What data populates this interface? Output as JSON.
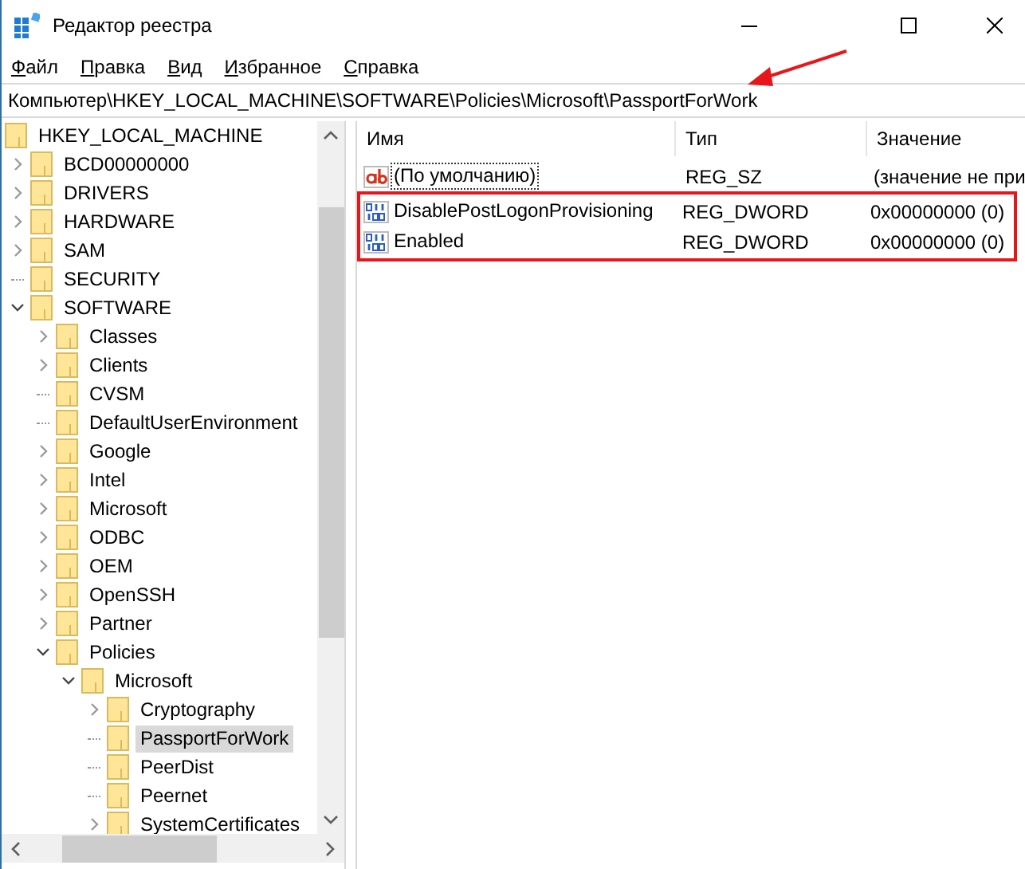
{
  "window": {
    "title": "Редактор реестра"
  },
  "menu": [
    {
      "label": "Файл"
    },
    {
      "label": "Правка"
    },
    {
      "label": "Вид"
    },
    {
      "label": "Избранное"
    },
    {
      "label": "Справка"
    }
  ],
  "address": "Компьютер\\HKEY_LOCAL_MACHINE\\SOFTWARE\\Policies\\Microsoft\\PassportForWork",
  "address_arrow": true,
  "tree": [
    {
      "label": "HKEY_LOCAL_MACHINE",
      "selected": false,
      "children": [
        {
          "label": "BCD00000000",
          "expandable": true,
          "expanded": false,
          "selected": false
        },
        {
          "label": "DRIVERS",
          "expandable": true,
          "expanded": false,
          "selected": false
        },
        {
          "label": "HARDWARE",
          "expandable": true,
          "expanded": false,
          "selected": false
        },
        {
          "label": "SAM",
          "expandable": true,
          "expanded": false,
          "selected": false
        },
        {
          "label": "SECURITY",
          "expandable": false,
          "selected": false
        },
        {
          "label": "SOFTWARE",
          "expandable": true,
          "expanded": true,
          "selected": false,
          "children": [
            {
              "label": "Classes",
              "expandable": true,
              "expanded": false,
              "selected": false
            },
            {
              "label": "Clients",
              "expandable": true,
              "expanded": false,
              "selected": false
            },
            {
              "label": "CVSM",
              "expandable": false,
              "selected": false
            },
            {
              "label": "DefaultUserEnvironment",
              "expandable": false,
              "selected": false
            },
            {
              "label": "Google",
              "expandable": true,
              "expanded": false,
              "selected": false
            },
            {
              "label": "Intel",
              "expandable": true,
              "expanded": false,
              "selected": false
            },
            {
              "label": "Microsoft",
              "expandable": true,
              "expanded": false,
              "selected": false
            },
            {
              "label": "ODBC",
              "expandable": true,
              "expanded": false,
              "selected": false
            },
            {
              "label": "OEM",
              "expandable": true,
              "expanded": false,
              "selected": false
            },
            {
              "label": "OpenSSH",
              "expandable": true,
              "expanded": false,
              "selected": false
            },
            {
              "label": "Partner",
              "expandable": true,
              "expanded": false,
              "selected": false
            },
            {
              "label": "Policies",
              "expandable": true,
              "expanded": true,
              "selected": false,
              "children": [
                {
                  "label": "Microsoft",
                  "expandable": true,
                  "expanded": true,
                  "selected": false,
                  "children": [
                    {
                      "label": "Cryptography",
                      "expandable": true,
                      "expanded": false,
                      "selected": false
                    },
                    {
                      "label": "PassportForWork",
                      "expandable": false,
                      "selected": true
                    },
                    {
                      "label": "PeerDist",
                      "expandable": false,
                      "selected": false
                    },
                    {
                      "label": "Peernet",
                      "expandable": false,
                      "selected": false
                    },
                    {
                      "label": "SystemCertificates",
                      "expandable": true,
                      "expanded": false,
                      "selected": false
                    }
                  ]
                }
              ]
            }
          ]
        }
      ]
    }
  ],
  "table": {
    "columns": [
      "Имя",
      "Тип",
      "Значение"
    ],
    "rows": [
      {
        "kind": "string",
        "name": "(По умолчанию)",
        "type": "REG_SZ",
        "value": "(значение не при",
        "focused": true,
        "highlighted": false
      },
      {
        "kind": "dword",
        "name": "DisablePostLogonProvisioning",
        "type": "REG_DWORD",
        "value": "0x00000000 (0)",
        "focused": false,
        "highlighted": true
      },
      {
        "kind": "dword",
        "name": "Enabled",
        "type": "REG_DWORD",
        "value": "0x00000000 (0)",
        "focused": false,
        "highlighted": true
      }
    ]
  }
}
